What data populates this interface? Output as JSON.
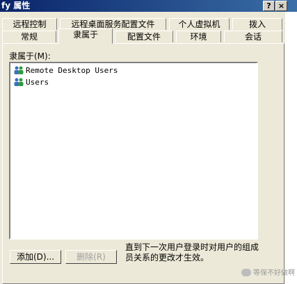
{
  "window": {
    "title": "fy 属性",
    "help_label": "?",
    "close_label": "×"
  },
  "tabs_back": [
    "远程控制",
    "远程桌面服务配置文件",
    "个人虚拟机",
    "拨入"
  ],
  "tabs_front": [
    "常规",
    "隶属于",
    "配置文件",
    "环境",
    "会话"
  ],
  "active_tab": "隶属于",
  "member_of": {
    "label": "隶属于(M):",
    "items": [
      "Remote Desktop Users",
      "Users"
    ]
  },
  "buttons": {
    "add": "添加(D)...",
    "remove": "删除(R)"
  },
  "note": "直到下一次用户登录时对用户的组成员关系的更改才生效。",
  "watermark": "等保不好做啊"
}
